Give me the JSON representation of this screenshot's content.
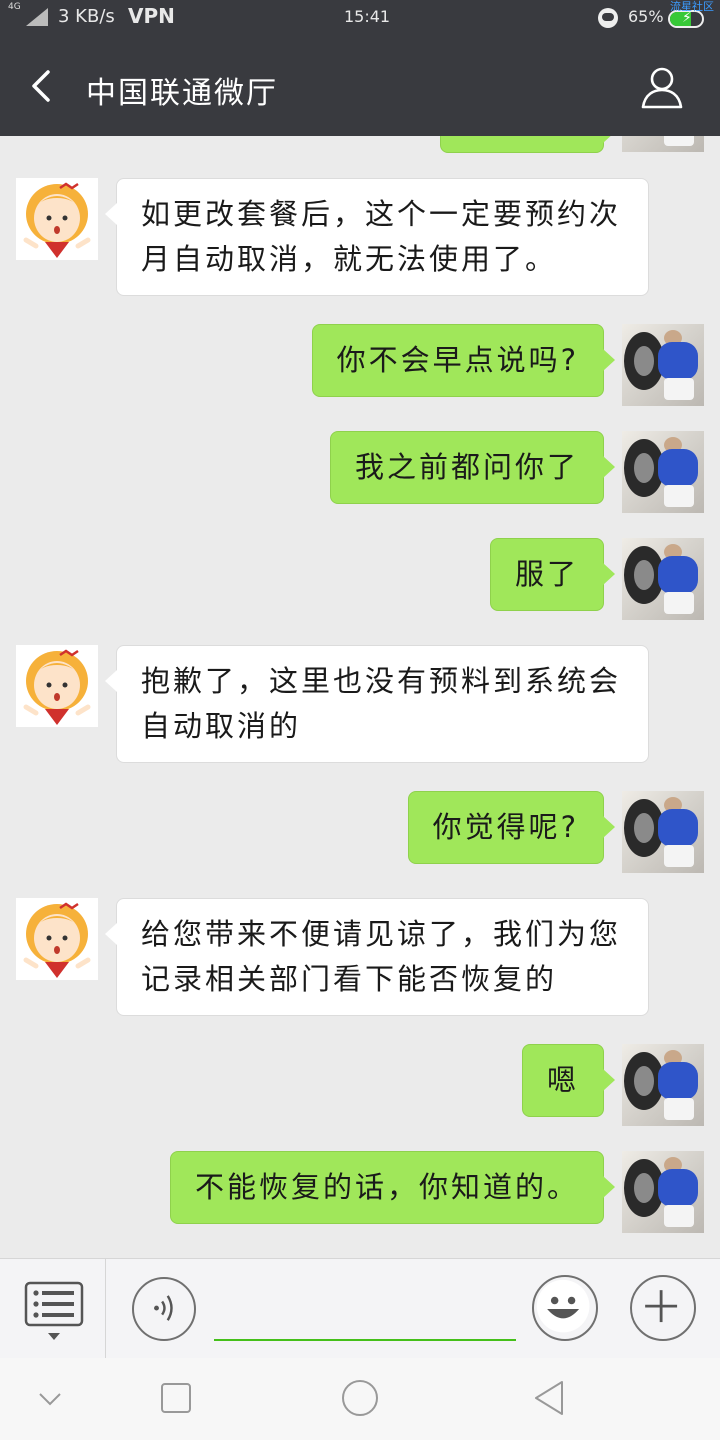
{
  "status_bar": {
    "signal_label": "4G",
    "net_speed": "3 KB/s",
    "vpn": "VPN",
    "time": "15:41",
    "battery_pct": "65%",
    "battery_level": 0.65,
    "watermark": "流星社区"
  },
  "header": {
    "title": "中国联通微厅"
  },
  "messages": [
    {
      "sender": "agent",
      "text": "如更改套餐后，这个一定要预约次月自动取消，就无法使用了。"
    },
    {
      "sender": "user",
      "text": "你不会早点说吗?"
    },
    {
      "sender": "user",
      "text": "我之前都问你了"
    },
    {
      "sender": "user",
      "text": "服了"
    },
    {
      "sender": "agent",
      "text": "抱歉了，这里也没有预料到系统会自动取消的"
    },
    {
      "sender": "user",
      "text": "你觉得呢?"
    },
    {
      "sender": "agent",
      "text": "给您带来不便请见谅了，我们为您记录相关部门看下能否恢复的"
    },
    {
      "sender": "user",
      "text": "嗯"
    },
    {
      "sender": "user",
      "text": "不能恢复的话，你知道的。"
    }
  ],
  "input_bar": {
    "icons": [
      "menu-icon",
      "voice-icon",
      "emoji-icon",
      "plus-icon"
    ]
  },
  "nav_bar": {
    "icons": [
      "collapse-icon",
      "recent-apps-icon",
      "home-icon",
      "back-icon"
    ]
  },
  "colors": {
    "header_bg": "#393a3f",
    "chat_bg": "#ebebeb",
    "user_bubble": "#a0e75a",
    "agent_bubble": "#ffffff",
    "input_accent": "#45c01a"
  }
}
